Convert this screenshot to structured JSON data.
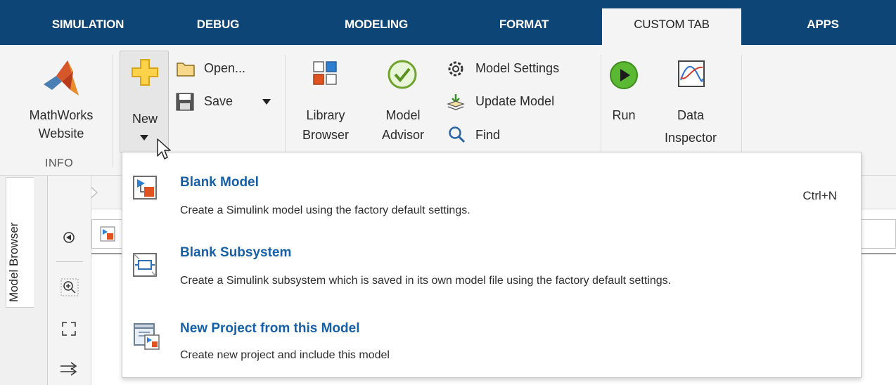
{
  "tabs": [
    {
      "label": "SIMULATION",
      "active": false
    },
    {
      "label": "DEBUG",
      "active": false
    },
    {
      "label": "MODELING",
      "active": false
    },
    {
      "label": "FORMAT",
      "active": false
    },
    {
      "label": "CUSTOM TAB",
      "active": true
    },
    {
      "label": "APPS",
      "active": false
    }
  ],
  "ribbon": {
    "info": {
      "mathworks_line1": "MathWorks",
      "mathworks_line2": "Website",
      "section_label": "INFO"
    },
    "file": {
      "new_label": "New",
      "open_label": "Open...",
      "save_label": "Save"
    },
    "library": {
      "line1": "Library",
      "line2": "Browser"
    },
    "advisor": {
      "line1": "Model",
      "line2": "Advisor"
    },
    "model_settings_label": "Model Settings",
    "update_model_label": "Update Model",
    "find_label": "Find",
    "run_label": "Run",
    "data_inspector": {
      "line1": "Data",
      "line2": "Inspector"
    }
  },
  "sidebar": {
    "model_browser_label": "Model Browser"
  },
  "menu": {
    "items": [
      {
        "title": "Blank Model",
        "desc": "Create a Simulink model using the factory default settings.",
        "shortcut": "Ctrl+N"
      },
      {
        "title": "Blank Subsystem",
        "desc": "Create a Simulink subsystem which is saved in its own model file using the factory default settings."
      },
      {
        "title": "New Project from this Model",
        "desc": "Create new project and include this model"
      }
    ]
  },
  "colors": {
    "tab_bar": "#0e4577",
    "menu_title": "#1660a8",
    "ribbon_bg": "#f4f4f4",
    "run_green": "#4caf28"
  }
}
